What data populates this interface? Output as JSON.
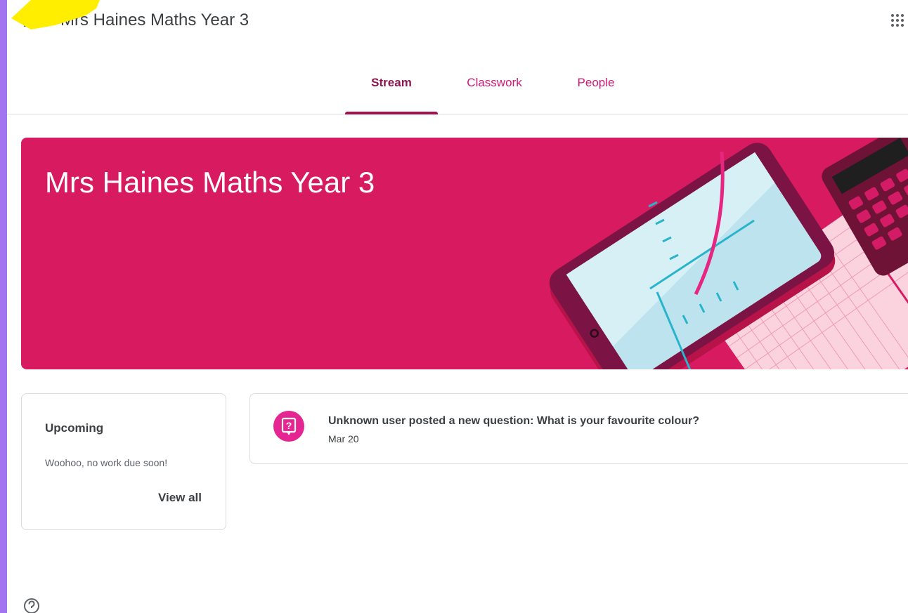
{
  "header": {
    "app_title": "Mrs Haines Maths Year 3",
    "menu_icon": "hamburger-menu-icon",
    "apps_icon": "google-apps-grid-icon"
  },
  "tabs": [
    {
      "label": "Stream",
      "active": true
    },
    {
      "label": "Classwork",
      "active": false
    },
    {
      "label": "People",
      "active": false
    }
  ],
  "banner": {
    "title": "Mrs Haines Maths Year 3",
    "color": "#d81b60"
  },
  "upcoming": {
    "title": "Upcoming",
    "message": "Woohoo, no work due soon!",
    "view_all": "View all"
  },
  "stream": {
    "posts": [
      {
        "text": "Unknown user posted a new question: What is your favourite colour?",
        "date": "Mar 20",
        "icon": "question-icon"
      }
    ]
  },
  "footer": {
    "help_icon": "help-icon"
  },
  "colors": {
    "accent": "#d01876",
    "active_tab": "#8f1550",
    "frame": "#a374f0",
    "highlight_arrow": "#ffee00"
  }
}
